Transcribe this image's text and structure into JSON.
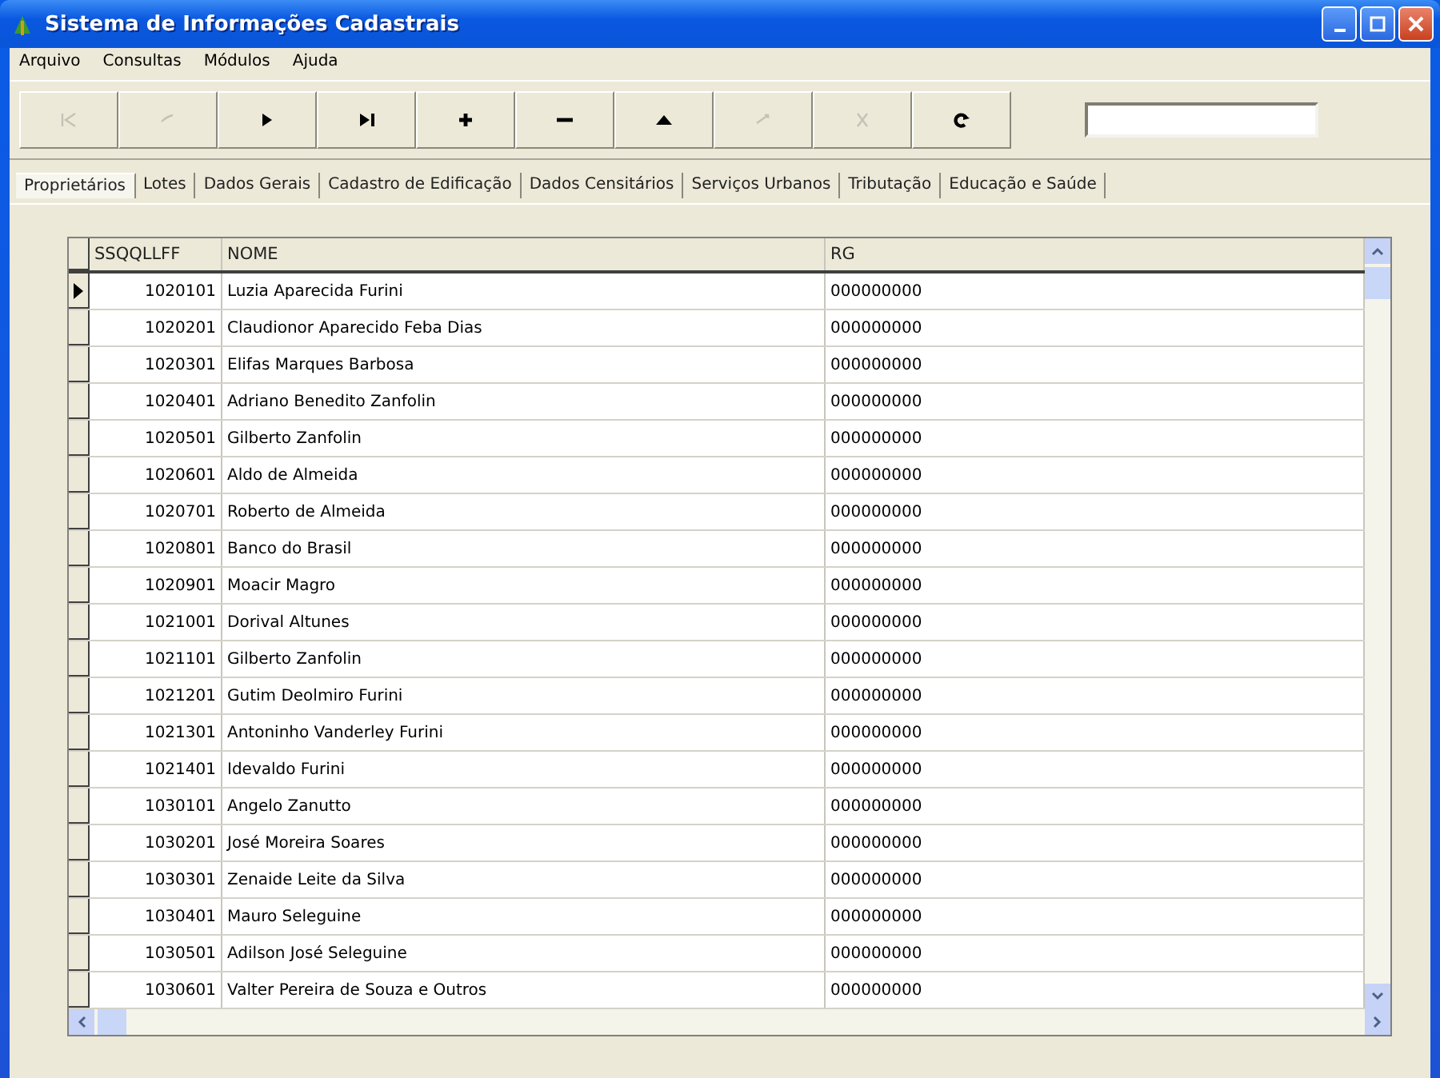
{
  "window": {
    "title": "Sistema de Informações Cadastrais"
  },
  "menu": [
    "Arquivo",
    "Consultas",
    "Módulos",
    "Ajuda"
  ],
  "toolbar": [
    {
      "kind": "first",
      "disabled": true
    },
    {
      "kind": "prior",
      "disabled": true
    },
    {
      "kind": "next",
      "disabled": false
    },
    {
      "kind": "last",
      "disabled": false
    },
    {
      "kind": "insert",
      "disabled": false
    },
    {
      "kind": "delete",
      "disabled": false
    },
    {
      "kind": "edit",
      "disabled": false
    },
    {
      "kind": "post",
      "disabled": true
    },
    {
      "kind": "cancel",
      "disabled": true
    },
    {
      "kind": "refresh",
      "disabled": false
    }
  ],
  "tabs": [
    {
      "label": "Proprietários",
      "selected": true
    },
    {
      "label": "Lotes",
      "selected": false
    },
    {
      "label": "Dados Gerais",
      "selected": false
    },
    {
      "label": "Cadastro de Edificação",
      "selected": false
    },
    {
      "label": "Dados Censitários",
      "selected": false
    },
    {
      "label": "Serviços Urbanos",
      "selected": false
    },
    {
      "label": "Tributação",
      "selected": false
    },
    {
      "label": "Educação e Saúde",
      "selected": false
    }
  ],
  "table": {
    "columns": [
      "SSQQLLFF",
      "NOME",
      "RG"
    ],
    "rows": [
      {
        "code": "1020101",
        "name": "Luzia Aparecida Furini",
        "rg": "000000000",
        "current": true
      },
      {
        "code": "1020201",
        "name": "Claudionor Aparecido Feba Dias",
        "rg": "000000000",
        "current": false
      },
      {
        "code": "1020301",
        "name": "Elifas Marques Barbosa",
        "rg": "000000000",
        "current": false
      },
      {
        "code": "1020401",
        "name": "Adriano Benedito Zanfolin",
        "rg": "000000000",
        "current": false
      },
      {
        "code": "1020501",
        "name": "Gilberto Zanfolin",
        "rg": "000000000",
        "current": false
      },
      {
        "code": "1020601",
        "name": "Aldo de Almeida",
        "rg": "000000000",
        "current": false
      },
      {
        "code": "1020701",
        "name": "Roberto de Almeida",
        "rg": "000000000",
        "current": false
      },
      {
        "code": "1020801",
        "name": "Banco do Brasil",
        "rg": "000000000",
        "current": false
      },
      {
        "code": "1020901",
        "name": "Moacir Magro",
        "rg": "000000000",
        "current": false
      },
      {
        "code": "1021001",
        "name": "Dorival Altunes",
        "rg": "000000000",
        "current": false
      },
      {
        "code": "1021101",
        "name": "Gilberto Zanfolin",
        "rg": "000000000",
        "current": false
      },
      {
        "code": "1021201",
        "name": "Gutim Deolmiro Furini",
        "rg": "000000000",
        "current": false
      },
      {
        "code": "1021301",
        "name": "Antoninho Vanderley Furini",
        "rg": "000000000",
        "current": false
      },
      {
        "code": "1021401",
        "name": "Idevaldo Furini",
        "rg": "000000000",
        "current": false
      },
      {
        "code": "1030101",
        "name": "Angelo Zanutto",
        "rg": "000000000",
        "current": false
      },
      {
        "code": "1030201",
        "name": "José Moreira Soares",
        "rg": "000000000",
        "current": false
      },
      {
        "code": "1030301",
        "name": "Zenaide Leite da Silva",
        "rg": "000000000",
        "current": false
      },
      {
        "code": "1030401",
        "name": "Mauro Seleguine",
        "rg": "000000000",
        "current": false
      },
      {
        "code": "1030501",
        "name": "Adilson José Seleguine",
        "rg": "000000000",
        "current": false
      },
      {
        "code": "1030601",
        "name": "Valter Pereira de Souza e Outros",
        "rg": "000000000",
        "current": false
      }
    ]
  }
}
